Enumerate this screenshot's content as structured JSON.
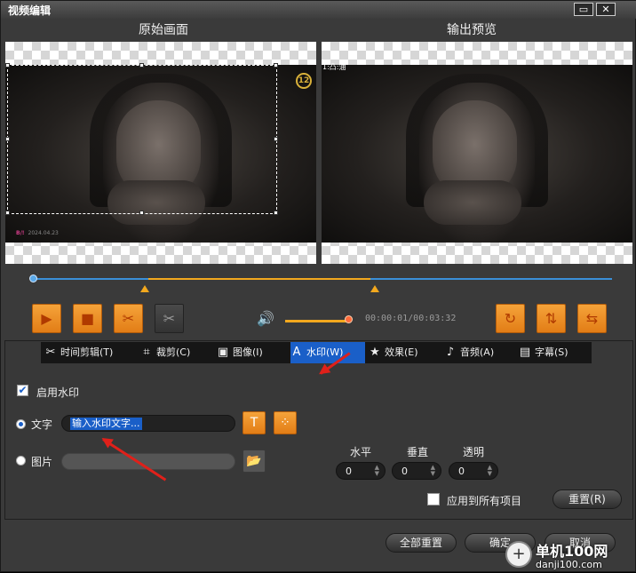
{
  "window": {
    "title": "视频编辑",
    "maximize_glyph": "▭",
    "close_glyph": "✕"
  },
  "preview": {
    "original_label": "原始画面",
    "output_label": "输出预览",
    "age_badge": "12",
    "broadcast_mark": "B/!",
    "broadcast_date": "2024.04.23",
    "output_overlay_text": "1:凸:油"
  },
  "player": {
    "timecode": "00:00:01/00:03:32",
    "volume_level": 0.95,
    "icons": [
      "play-icon",
      "stop-icon",
      "cut-icon",
      "scissors-disabled-icon",
      "rotate-icon",
      "flip-vertical-icon",
      "flip-horizontal-icon",
      "volume-icon"
    ]
  },
  "tabs": [
    {
      "label": "时间剪辑(T)",
      "icon": "scissors-icon",
      "active": false
    },
    {
      "label": "裁剪(C)",
      "icon": "crop-icon",
      "active": false
    },
    {
      "label": "图像(I)",
      "icon": "image-icon",
      "active": false
    },
    {
      "label": "水印(W)",
      "icon": "watermark-icon",
      "active": true
    },
    {
      "label": "效果(E)",
      "icon": "star-icon",
      "active": false
    },
    {
      "label": "音频(A)",
      "icon": "music-icon",
      "active": false
    },
    {
      "label": "字幕(S)",
      "icon": "subtitle-icon",
      "active": false
    }
  ],
  "watermark": {
    "enable_label": "启用水印",
    "enable_checked": true,
    "text_option_label": "文字",
    "text_placeholder_selected": "输入水印文字...",
    "image_option_label": "图片",
    "horizontal_label": "水平",
    "vertical_label": "垂直",
    "opacity_label": "透明",
    "horizontal_value": "0",
    "vertical_value": "0",
    "opacity_value": "0",
    "apply_all_label": "应用到所有项目",
    "reset_label": "重置(R)"
  },
  "footer": {
    "reset_all_label": "全部重置",
    "ok_label": "确定",
    "cancel_label": "取消"
  },
  "overlay_watermark": {
    "brand": "单机100网",
    "url": "danji100.com"
  },
  "colors": {
    "accent": "#f2a81e",
    "active_tab": "#1a5fc8",
    "arrow": "#e0201a",
    "timeline": "#3a8fd8"
  }
}
